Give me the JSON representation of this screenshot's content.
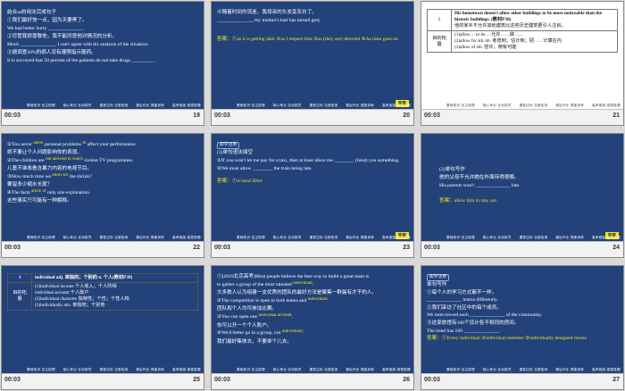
{
  "slides": [
    {
      "time": "00:03",
      "num": "19",
      "lines": [
        "结合as的用法完成句子",
        "①我们最好快一点，因为天要黑了。",
        "We had better hurry ______________.",
        "②尽管我很尊敬他，我不能同意他对情况的分析。",
        "Much ______________, I can't agree with his analysis of the situation.",
        "③据调查50%的病人没有遵照指示服药。",
        "It is surveyed that 50 percent of the patients do not take drugs _________."
      ]
    },
    {
      "time": "00:03",
      "num": "20",
      "lines": [
        "④随着时间的流逝，我母亲的头发变灰白了。",
        "______________, my mother's hair has turned grey."
      ],
      "answer": "答案：①as it is getting dark  ②as I respect him  ③as (they are) directed  ④As time goes on",
      "tag": "答案"
    },
    {
      "time": "00:03",
      "num": "21",
      "row_num": "5",
      "row_text": "His hometown doesn't allow other buildings to be more noticeable than the historic buildings. (教材P38)",
      "row_cn": "他的家乡不允许其他建筑比这些历史建筑更引人注目。",
      "side_label": "目的拓展",
      "items": [
        "(1)allow ... to do ... 允许……做……",
        "(2)allow for sth./sb. 考虑到；估计到；把……计算在内",
        "(3)allow of sth. 容许；使有可能"
      ]
    },
    {
      "time": "00:03",
      "num": "22",
      "lines": [
        "①You never ______ personal problems ______ affect your performance.",
        "绝不要让个人问题影响你的表现。",
        "②The children are ______________ violent TV programmes.",
        "儿童不准收看含暴力内容的电视节目。",
        "③How much time we ______________ the shrink?",
        "要留多少缩水长度？",
        "④The facts ______________ only one explanation.",
        "这些事实只可能有一种解释。"
      ],
      "hints": [
        "allow",
        "to",
        "not allowed to watch",
        "allow for",
        "allow of"
      ]
    },
    {
      "time": "00:03",
      "num": "23",
      "pill": "即学活用",
      "lines": [
        "(1)单句语法填空",
        "①If you won't let me pay for a taxi, then at least allow me ________ (lend) you something.",
        "②We must allow ________ the train being late."
      ],
      "answer": "答案：①to lend  ②for",
      "tag": "答案"
    },
    {
      "time": "00:03",
      "num": "24",
      "lines": [
        "(2)单句写作",
        "他的父母不允许她在外面待得很晚。",
        "His parents won't ______________ late."
      ],
      "answer": "答案：allow him to stay out",
      "tag": "答案"
    },
    {
      "time": "00:03",
      "num": "25",
      "row_num": "4",
      "row_text": "individual adj. 单独的；个别的  n. 个人(教材P39)",
      "side_label": "目的拓展",
      "items": [
        "(1)individual income 个人收入；个人所得",
        "individual account 个人账户",
        "(2)individual character 独特性；个性；个性人物",
        "(3)individually adv. 单独地；个别地"
      ]
    },
    {
      "time": "00:03",
      "num": "26",
      "lines": [
        "①(2019北京高考)Most people believe the best way to build a great team is",
        "to gather a group of the most talented ______________.",
        "大多数人认为组建一支优秀的团队的最好方法是聚集一群最有才干的人。",
        "②The competition is open to both teams and ______________.",
        "团队和个人均可参加比赛。",
        "③You can open one ______________.",
        "你可以开一个个人账户。",
        "④We'd better go in a group, not ______________.",
        "我们最好集体去，不要单个儿去。"
      ],
      "hints": [
        "individuals",
        "individuals",
        "individual account",
        "individually"
      ]
    },
    {
      "time": "00:03",
      "num": "27",
      "pill": "即学活用",
      "lines": [
        "单句写作",
        "①每个人的学习方式都不一样。",
        "______________ learns differently.",
        "②我们采访了社区中的每个成员。",
        "We interviewed each ______________ of the community.",
        "③这家旅馆有100个设计各不相同的房间。",
        "The hotel has 100 ______________."
      ],
      "answer": "答案：①Every individual  ②individual member  ③individually designed rooms",
      "tag": "答案"
    }
  ],
  "footer_links": [
    "基础知识·自主梳理",
    "核心考点·互动探究",
    "课堂达标·当堂检测",
    "课后作业·提能训练",
    "高考链接·感悟真题",
    "综合测评"
  ],
  "colors": {
    "slide_bg": "#23427a",
    "answer": "#f5e81b",
    "bar": "#f2f2f2"
  }
}
